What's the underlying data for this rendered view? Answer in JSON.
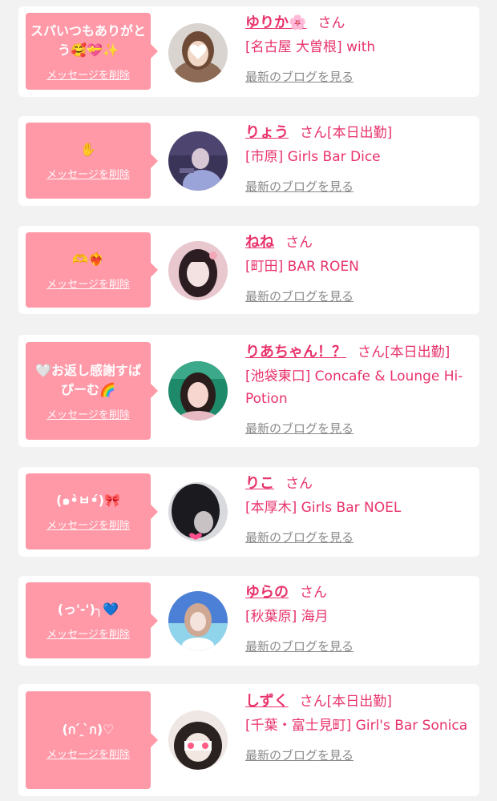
{
  "delete_label": "メッセージを削除",
  "blog_label": "最新のブログを見る",
  "san": "さん",
  "colors": {
    "bubble": "#ff99a8",
    "name": "#e8336b",
    "background": "#f2f2f2",
    "blog_link": "#8a8a8a"
  },
  "cards": [
    {
      "message": "スパいつもありがとう🥰💝✨",
      "name": "ゆりか🌸",
      "status": "",
      "shop": "[名古屋 大曽根] with",
      "avatar_icon": "avatar-photo"
    },
    {
      "message": "✋",
      "name": "りょう",
      "status": "[本日出勤]",
      "shop": "[市原] Girls Bar Dice",
      "avatar_icon": "avatar-photo"
    },
    {
      "message": "🫶❤️‍🔥",
      "name": "ねね",
      "status": "",
      "shop": "[町田] BAR ROEN",
      "avatar_icon": "avatar-photo"
    },
    {
      "message": "🤍お返し感謝すぱぴーむ🌈",
      "name": "りあちゃん！？",
      "status": "[本日出勤]",
      "shop": "[池袋東口] Concafe & Lounge Hi-Potion",
      "avatar_icon": "avatar-photo"
    },
    {
      "message": "(๑•̀ㅂ•́)🎀",
      "name": "りこ",
      "status": "",
      "shop": "[本厚木] Girls Bar NOEL",
      "avatar_icon": "avatar-photo"
    },
    {
      "message": "(っ'-')╮💙",
      "name": "ゆらの",
      "status": "",
      "shop": "[秋葉原] 海月",
      "avatar_icon": "avatar-photo"
    },
    {
      "message": "(ก ́ ̯ ̀ก)♡",
      "name": "しずく",
      "status": "[本日出勤]",
      "shop": "[千葉・富士見町] Girl's Bar Sonica",
      "avatar_icon": "avatar-photo"
    }
  ]
}
